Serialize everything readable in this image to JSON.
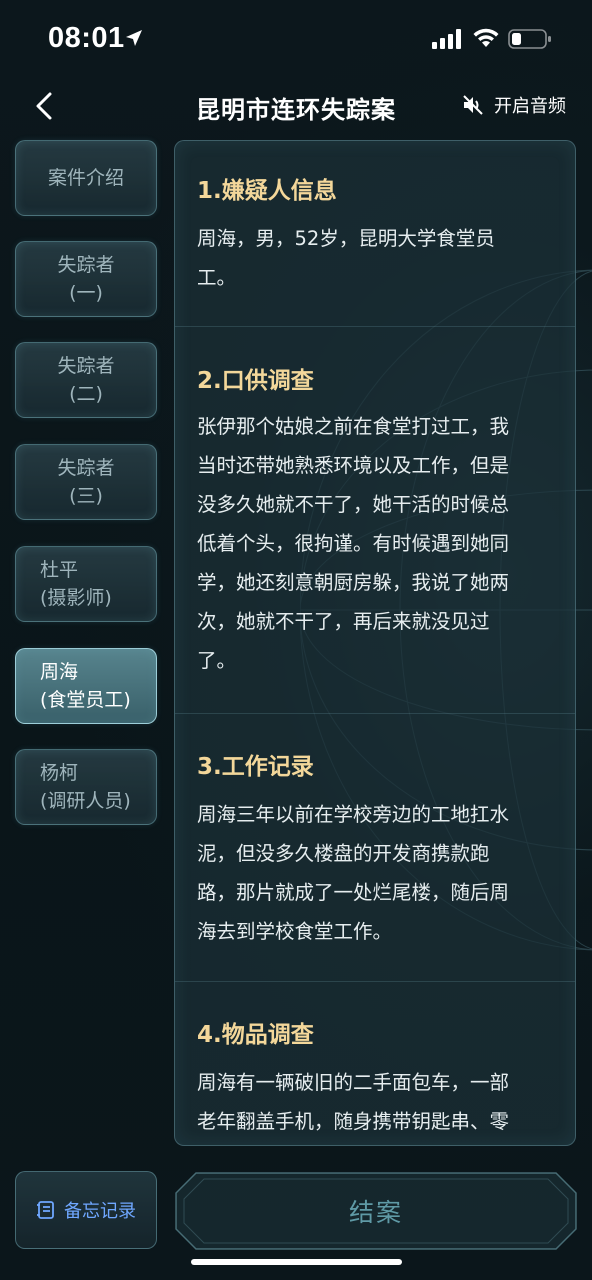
{
  "status_bar": {
    "time": "08:01"
  },
  "header": {
    "title": "昆明市连环失踪案",
    "audio_label": "开启音频"
  },
  "sidebar": {
    "items": [
      {
        "line1": "案件介绍",
        "line2": ""
      },
      {
        "line1": "失踪者",
        "line2": "(一)"
      },
      {
        "line1": "失踪者",
        "line2": "(二)"
      },
      {
        "line1": "失踪者",
        "line2": "(三)"
      },
      {
        "line1": "杜平",
        "line2": "(摄影师)"
      },
      {
        "line1": "周海",
        "line2": "(食堂员工)"
      },
      {
        "line1": "杨柯",
        "line2": "(调研人员)"
      }
    ],
    "active_index": 5
  },
  "content": {
    "sections": [
      {
        "title": "1.嫌疑人信息",
        "body": [
          "周海，男，52岁，昆明大学食堂员",
          "工。"
        ]
      },
      {
        "title": "2.口供调查",
        "body": [
          "张伊那个姑娘之前在食堂打过工，我",
          "当时还带她熟悉环境以及工作，但是",
          "没多久她就不干了，她干活的时候总",
          "低着个头，很拘谨。有时候遇到她同",
          "学，她还刻意朝厨房躲，我说了她两",
          "次，她就不干了，再后来就没见过",
          "了。"
        ]
      },
      {
        "title": "3.工作记录",
        "body": [
          "周海三年以前在学校旁边的工地扛水",
          "泥，但没多久楼盘的开发商携款跑",
          "路，那片就成了一处烂尾楼，随后周",
          "海去到学校食堂工作。"
        ]
      },
      {
        "title": "4.物品调查",
        "body": [
          "周海有一辆破旧的二手面包车，一部",
          "老年翻盖手机，随身携带钥匙串、零"
        ]
      }
    ]
  },
  "bottom": {
    "memo_label": "备忘记录",
    "close_case_label": "结案"
  },
  "colors": {
    "accent_title": "#f3d79a",
    "memo_blue": "#6fa7ff",
    "close_case_text": "#5f9aa6"
  }
}
